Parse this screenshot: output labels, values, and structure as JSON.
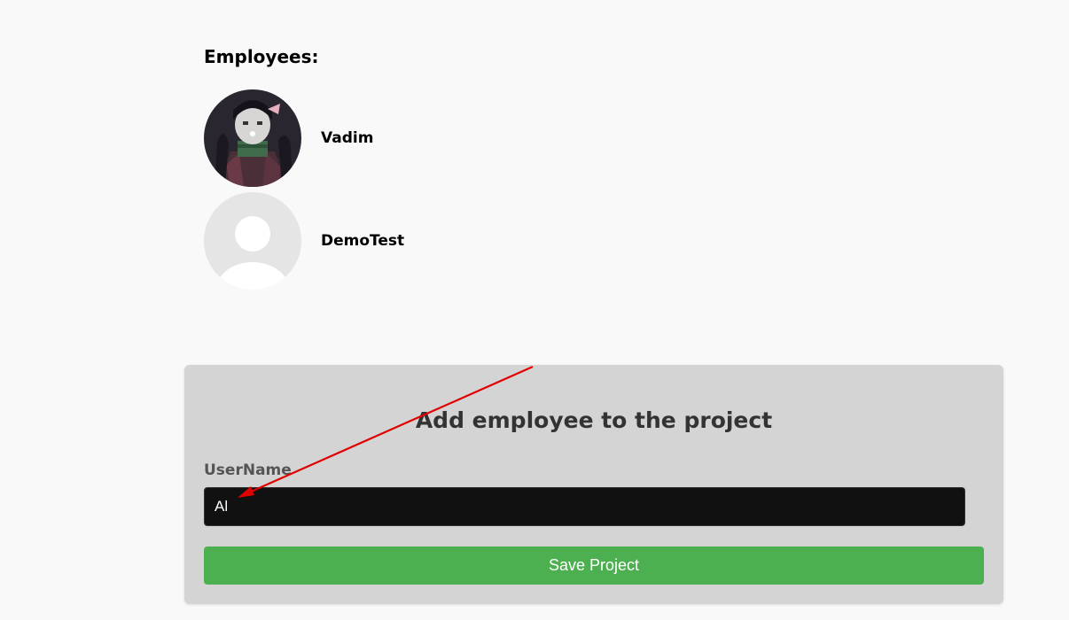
{
  "employees": {
    "heading": "Employees:",
    "items": [
      {
        "name": "Vadim",
        "avatar": "anime-character-avatar"
      },
      {
        "name": "DemoTest",
        "avatar": "default-user-placeholder-icon"
      }
    ]
  },
  "add_employee_form": {
    "title": "Add employee to the project",
    "username_label": "UserName",
    "username_value": "Al",
    "save_label": "Save Project"
  },
  "colors": {
    "page_background": "#f9f9f9",
    "card_background": "#d4d4d4",
    "input_background": "#111111",
    "save_button": "#4caf50",
    "annotation_arrow": "#e00000"
  }
}
